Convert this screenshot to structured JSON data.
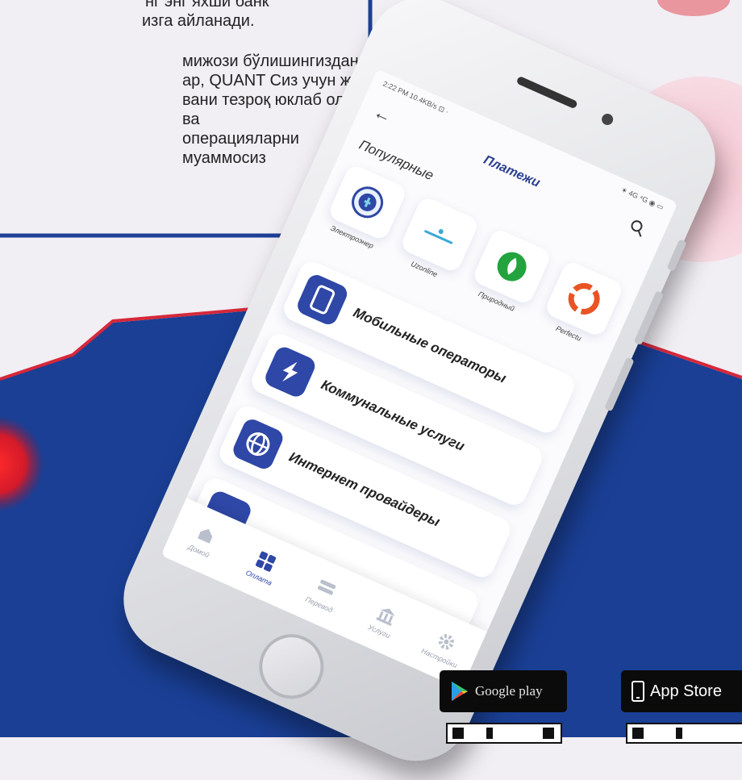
{
  "intro": {
    "line1": "нг энг яхши банк",
    "line2": "изга айланади.",
    "paragraph": "мижози бўлишингиздан\nар, QUANT Сиз учун жуда\nвани тезроқ юклаб олинг ва\nоперацияларни муаммосиз"
  },
  "status": {
    "left": "2:22 PM  10.4KB/s ⊡ ·",
    "right": "✶ 4G ⁴G ◉ ▭"
  },
  "app": {
    "title": "Платежи",
    "section": "Популярные",
    "popular": [
      {
        "label": "Электроэнер",
        "icon": "electricity-logo"
      },
      {
        "label": "Uzonline",
        "icon": "uzonline-logo"
      },
      {
        "label": "Природный",
        "icon": "natural-gas-logo"
      },
      {
        "label": "Perfectu",
        "icon": "perfectum-logo"
      }
    ],
    "categories": [
      {
        "label": "Мобильные операторы",
        "icon": "mobile-phone-icon"
      },
      {
        "label": "Коммунальные услуги",
        "icon": "lightning-icon"
      },
      {
        "label": "Интернет провайдеры",
        "icon": "globe-icon"
      }
    ],
    "tabs": [
      {
        "label": "Домой",
        "icon": "home-icon"
      },
      {
        "label": "Оплата",
        "icon": "grid-icon"
      },
      {
        "label": "Перевод",
        "icon": "transfer-icon"
      },
      {
        "label": "Услуги",
        "icon": "bank-icon"
      },
      {
        "label": "Настройки",
        "icon": "gear-icon"
      }
    ]
  },
  "badges": {
    "google_play": "Google play",
    "app_store": "App Store"
  },
  "colors": {
    "brand_blue": "#2f47a6",
    "background": "#f1eef4",
    "navy": "#1a3f95",
    "red": "#d6283a"
  }
}
